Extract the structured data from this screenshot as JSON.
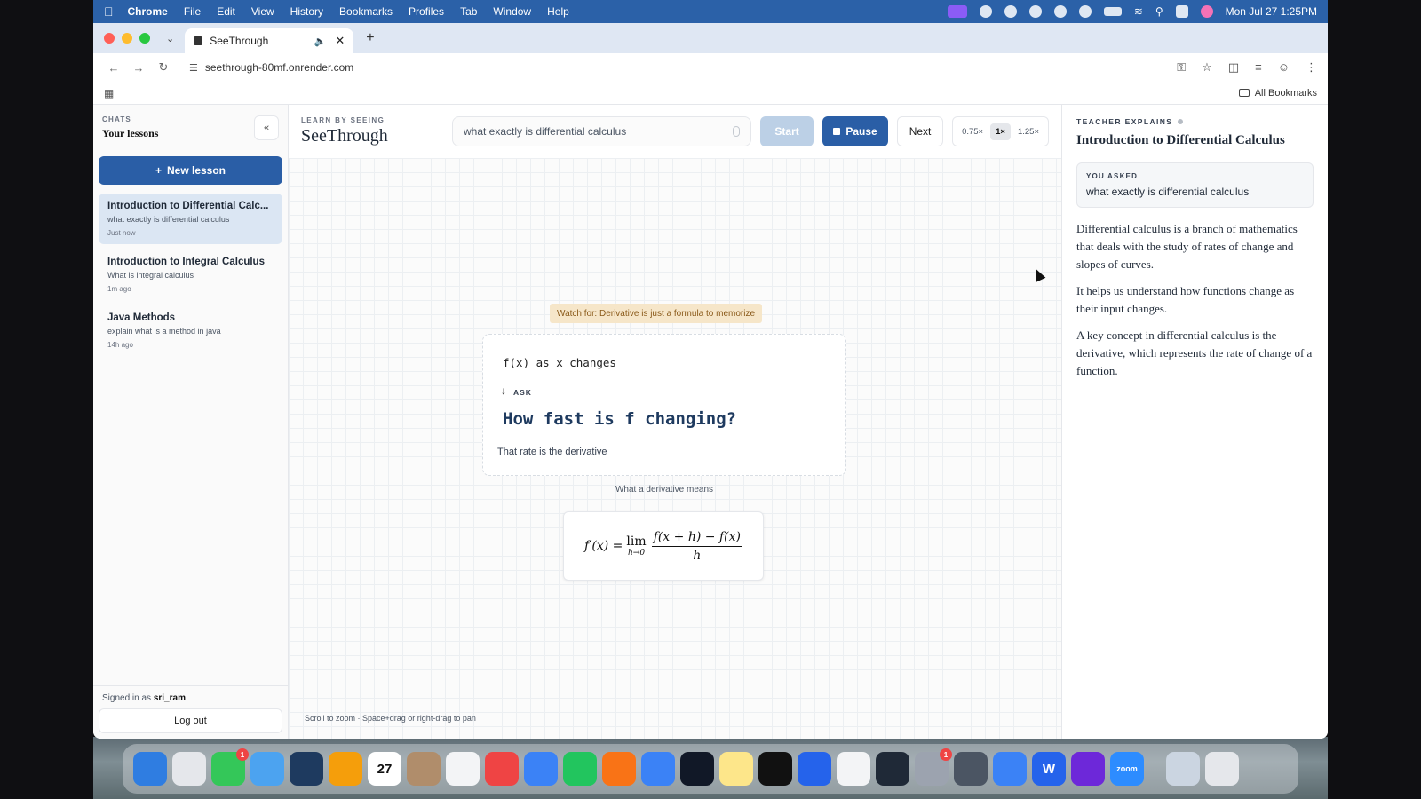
{
  "menubar": {
    "app": "Chrome",
    "items": [
      "File",
      "Edit",
      "View",
      "History",
      "Bookmarks",
      "Profiles",
      "Tab",
      "Window",
      "Help"
    ],
    "clock": "Mon Jul 27  1:25PM"
  },
  "browser": {
    "tab_title": "SeeThrough",
    "url": "seethrough-80mf.onrender.com",
    "all_bookmarks": "All Bookmarks"
  },
  "sidebar": {
    "eyebrow": "CHATS",
    "title": "Your lessons",
    "collapse": "«",
    "new_lesson": "New lesson",
    "lessons": [
      {
        "title": "Introduction to Differential Calc...",
        "subtitle": "what exactly is differential calculus",
        "time": "Just now"
      },
      {
        "title": "Introduction to Integral Calculus",
        "subtitle": "What is integral calculus",
        "time": "1m ago"
      },
      {
        "title": "Java Methods",
        "subtitle": "explain what is a method in java",
        "time": "14h ago"
      }
    ],
    "signed_in_prefix": "Signed in as",
    "username": "sri_ram",
    "logout": "Log out"
  },
  "topbar": {
    "eyebrow": "LEARN BY SEEING",
    "brand": "SeeThrough",
    "query": "what exactly is differential calculus",
    "start": "Start",
    "pause": "Pause",
    "next": "Next",
    "speeds": [
      "0.75×",
      "1×",
      "1.25×"
    ],
    "active_speed": "1×"
  },
  "canvas": {
    "watch_for": "Watch for: Derivative is just a formula to memorize",
    "concept_line": "f(x) as x changes",
    "ask_label": "ASK",
    "question": "How fast is f changing?",
    "rate_text": "That rate is the derivative",
    "caption": "What a derivative means",
    "formula": {
      "lhs": "f′(x) =",
      "lim": "lim",
      "lim_sub": "h→0",
      "numerator": "f(x + h) − f(x)",
      "denominator": "h"
    },
    "hint": "Scroll to zoom · Space+drag or right-drag to pan"
  },
  "teacher": {
    "eyebrow": "TEACHER EXPLAINS",
    "title": "Introduction to Differential Calculus",
    "asked_label": "YOU ASKED",
    "asked_text": "what exactly is differential calculus",
    "paragraphs": [
      "Differential calculus is a branch of mathematics that deals with the study of rates of change and slopes of curves.",
      "It helps us understand how functions change as their input changes.",
      "A key concept in differential calculus is the derivative, which represents the rate of change of a function."
    ]
  },
  "dock": {
    "apps": [
      {
        "name": "finder",
        "color": "#2f7de1",
        "label": ""
      },
      {
        "name": "launchpad",
        "color": "#e5e7eb",
        "label": ""
      },
      {
        "name": "messages",
        "color": "#34c759",
        "label": "",
        "badge": "1"
      },
      {
        "name": "maps",
        "color": "#4ca3f0",
        "label": ""
      },
      {
        "name": "stocks",
        "color": "#1e3a5f",
        "label": ""
      },
      {
        "name": "photos",
        "color": "#f59e0b",
        "label": ""
      },
      {
        "name": "calendar",
        "color": "#ffffff",
        "label": "27"
      },
      {
        "name": "contacts",
        "color": "#b08d6b",
        "label": ""
      },
      {
        "name": "reminders",
        "color": "#f3f4f6",
        "label": ""
      },
      {
        "name": "news",
        "color": "#ef4444",
        "label": ""
      },
      {
        "name": "keynote",
        "color": "#3b82f6",
        "label": ""
      },
      {
        "name": "numbers",
        "color": "#22c55e",
        "label": ""
      },
      {
        "name": "pages",
        "color": "#f97316",
        "label": ""
      },
      {
        "name": "safari",
        "color": "#3b82f6",
        "label": ""
      },
      {
        "name": "terminal-app",
        "color": "#111827",
        "label": ""
      },
      {
        "name": "notes",
        "color": "#fde68a",
        "label": ""
      },
      {
        "name": "cube-app",
        "color": "#111111",
        "label": ""
      },
      {
        "name": "app-store",
        "color": "#2563eb",
        "label": ""
      },
      {
        "name": "chrome",
        "color": "#f3f4f6",
        "label": ""
      },
      {
        "name": "editor",
        "color": "#1f2937",
        "label": ""
      },
      {
        "name": "system-settings",
        "color": "#9ca3af",
        "label": "",
        "badge": "1"
      },
      {
        "name": "simulator",
        "color": "#4b5563",
        "label": ""
      },
      {
        "name": "arc",
        "color": "#3b82f6",
        "label": ""
      },
      {
        "name": "word",
        "color": "#2563eb",
        "label": "W"
      },
      {
        "name": "github",
        "color": "#6d28d9",
        "label": ""
      },
      {
        "name": "zoom",
        "color": "#2d8cff",
        "label": "zoom"
      }
    ],
    "trailing": [
      {
        "name": "downloads-folder",
        "color": "#cbd5e1",
        "label": ""
      },
      {
        "name": "trash",
        "color": "#e5e7eb",
        "label": ""
      }
    ]
  }
}
